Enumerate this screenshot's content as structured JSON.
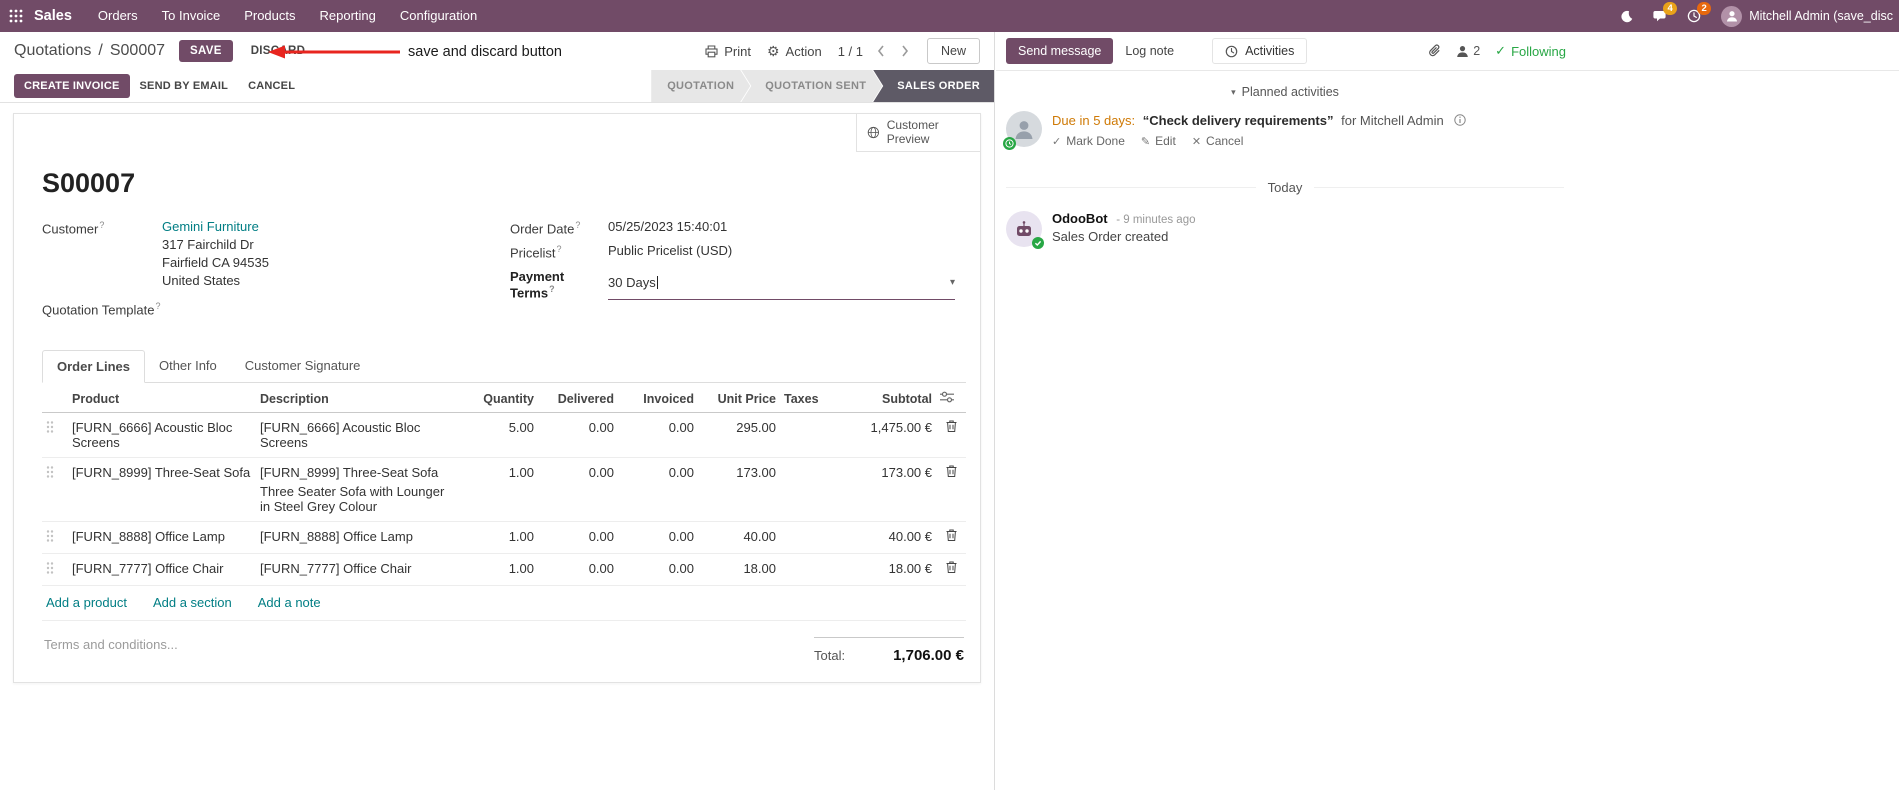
{
  "colors": {
    "primary": "#714B67",
    "link_teal": "#017e84",
    "modified_blue": "#2a6bd8",
    "arrow_red": "#e8251f",
    "following_green": "#28a745",
    "stage_active_bg": "#5e5a66",
    "due_orange": "#cf7a06"
  },
  "icons": {
    "caret_down": "▾",
    "gear": "⚙",
    "check": "✓",
    "pencil": "✎",
    "close": "✕"
  },
  "topbar": {
    "brand": "Sales",
    "menus": [
      "Orders",
      "To Invoice",
      "Products",
      "Reporting",
      "Configuration"
    ],
    "message_badge": "4",
    "activity_badge": "2",
    "user_name": "Mitchell Admin (save_disc"
  },
  "control_panel": {
    "breadcrumb_section": "Quotations",
    "breadcrumb_separator": "/",
    "breadcrumb_record": "S00007",
    "save_label": "SAVE",
    "discard_label": "DISCARD",
    "print_label": "Print",
    "action_label": "Action",
    "pager": "1 / 1",
    "new_label": "New"
  },
  "annotation": {
    "text": "save and discard button"
  },
  "statusbar": {
    "create_invoice": "CREATE INVOICE",
    "send_by_email": "SEND BY EMAIL",
    "cancel": "CANCEL",
    "stages": [
      {
        "label": "QUOTATION"
      },
      {
        "label": "QUOTATION SENT"
      },
      {
        "label": "SALES ORDER",
        "active": true
      }
    ]
  },
  "sheet": {
    "customer_preview": "Customer Preview",
    "help_marker": "?",
    "title": "S00007",
    "customer_label": "Customer",
    "customer_name": "Gemini Furniture",
    "customer_address": [
      "317 Fairchild Dr",
      "Fairfield CA 94535",
      "United States"
    ],
    "quotation_template_label": "Quotation Template",
    "order_date_label": "Order Date",
    "order_date_value": "05/25/2023 15:40:01",
    "pricelist_label": "Pricelist",
    "pricelist_value": "Public Pricelist (USD)",
    "payment_terms_label": "Payment Terms",
    "payment_terms_value": "30 Days",
    "tabs": [
      "Order Lines",
      "Other Info",
      "Customer Signature"
    ],
    "order_lines": {
      "headers": {
        "product": "Product",
        "description": "Description",
        "quantity": "Quantity",
        "delivered": "Delivered",
        "invoiced": "Invoiced",
        "unit_price": "Unit Price",
        "taxes": "Taxes",
        "subtotal": "Subtotal"
      },
      "rows": [
        {
          "product": "[FURN_6666] Acoustic Bloc Screens",
          "description": "[FURN_6666] Acoustic Bloc Screens",
          "quantity": "5.00",
          "delivered": "0.00",
          "invoiced": "0.00",
          "unit_price": "295.00",
          "taxes": "",
          "subtotal": "1,475.00 €"
        },
        {
          "product": "[FURN_8999] Three-Seat Sofa",
          "description": "[FURN_8999] Three-Seat Sofa",
          "description_line2": "Three Seater Sofa with Lounger in Steel Grey Colour",
          "quantity": "1.00",
          "delivered": "0.00",
          "invoiced": "0.00",
          "unit_price": "173.00",
          "taxes": "",
          "subtotal": "173.00 €",
          "modified": true
        },
        {
          "product": "[FURN_8888] Office Lamp",
          "description": "[FURN_8888] Office Lamp",
          "quantity": "1.00",
          "delivered": "0.00",
          "invoiced": "0.00",
          "unit_price": "40.00",
          "taxes": "",
          "subtotal": "40.00 €"
        },
        {
          "product": "[FURN_7777] Office Chair",
          "description": "[FURN_7777] Office Chair",
          "quantity": "1.00",
          "delivered": "0.00",
          "invoiced": "0.00",
          "unit_price": "18.00",
          "taxes": "",
          "subtotal": "18.00 €"
        }
      ],
      "add_product": "Add a product",
      "add_section": "Add a section",
      "add_note": "Add a note"
    },
    "terms_placeholder": "Terms and conditions...",
    "total_label": "Total:",
    "total_value": "1,706.00 €"
  },
  "chatter": {
    "send_message": "Send message",
    "log_note": "Log note",
    "activities": "Activities",
    "followers_count": "2",
    "following": "Following",
    "planned_activities_header": "Planned activities",
    "activity": {
      "due": "Due in 5 days:",
      "summary": "“Check delivery requirements”",
      "assignee": "for Mitchell Admin",
      "mark_done": "Mark Done",
      "edit": "Edit",
      "cancel": "Cancel"
    },
    "date_divider": "Today",
    "message": {
      "author": "OdooBot",
      "timestamp": "- 9 minutes ago",
      "body": "Sales Order created"
    }
  }
}
